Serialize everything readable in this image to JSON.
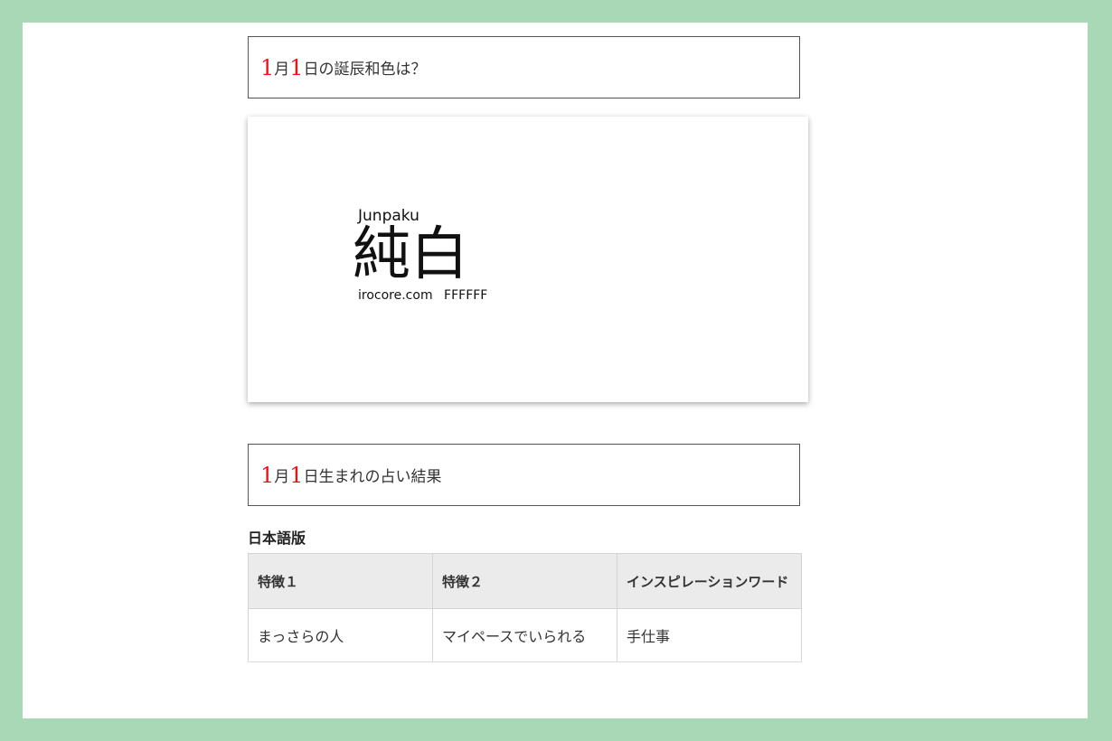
{
  "heading1": {
    "month": "1",
    "month_suffix": "月",
    "day": "1",
    "day_suffix": "日の誕辰和色は？"
  },
  "color_card": {
    "romaji": "Junpaku",
    "kanji": "純白",
    "source": "irocore.com",
    "hex_code": "FFFFFF"
  },
  "heading2": {
    "month": "1",
    "month_suffix": "月",
    "day": "1",
    "day_suffix": "日生まれの占い結果"
  },
  "table_section": {
    "title": "日本語版",
    "headers": [
      "特徴１",
      "特徴２",
      "インスピレーションワード"
    ],
    "row": [
      "まっさらの人",
      "マイペースでいられる",
      "手仕事"
    ]
  },
  "colors": {
    "frame": "#a8d8b5",
    "accent_number": "#e0161c"
  }
}
